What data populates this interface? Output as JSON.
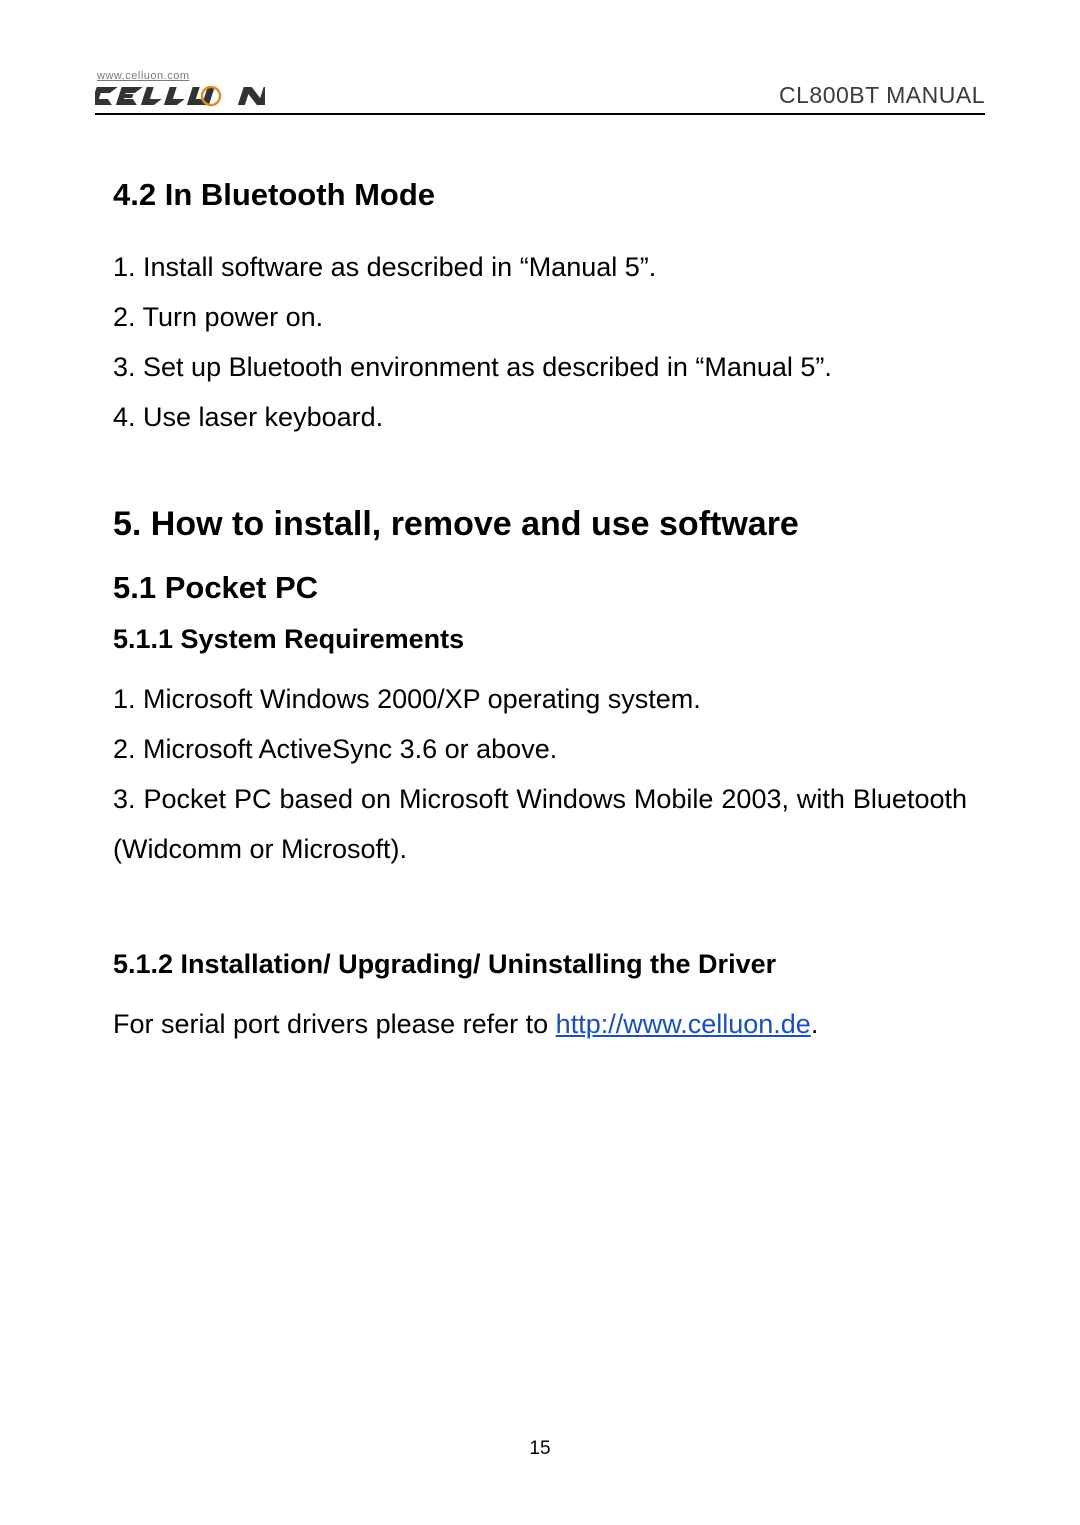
{
  "header": {
    "logo_url": "www.celluon.com",
    "manual_title": "CL800BT MANUAL"
  },
  "sections": {
    "s42": {
      "heading": "4.2 In Bluetooth Mode",
      "items": [
        "1. Install software as described in “Manual 5”.",
        "2. Turn power on.",
        "3. Set up Bluetooth environment as described in “Manual 5”.",
        "4. Use laser keyboard."
      ]
    },
    "s5": {
      "heading": "5. How to install, remove and use software"
    },
    "s51": {
      "heading": "5.1 Pocket PC"
    },
    "s511": {
      "heading": "5.1.1 System Requirements",
      "items": [
        "1. Microsoft Windows 2000/XP operating system.",
        "2. Microsoft ActiveSync 3.6 or above.",
        "3. Pocket PC based on Microsoft Windows Mobile 2003, with Bluetooth (Widcomm or Microsoft)."
      ]
    },
    "s512": {
      "heading": "5.1.2   Installation/ Upgrading/ Uninstalling the Driver",
      "text_before_link": "For serial port drivers please refer to ",
      "link_text": "http://www.celluon.de",
      "text_after_link": "."
    }
  },
  "page_number": "15"
}
